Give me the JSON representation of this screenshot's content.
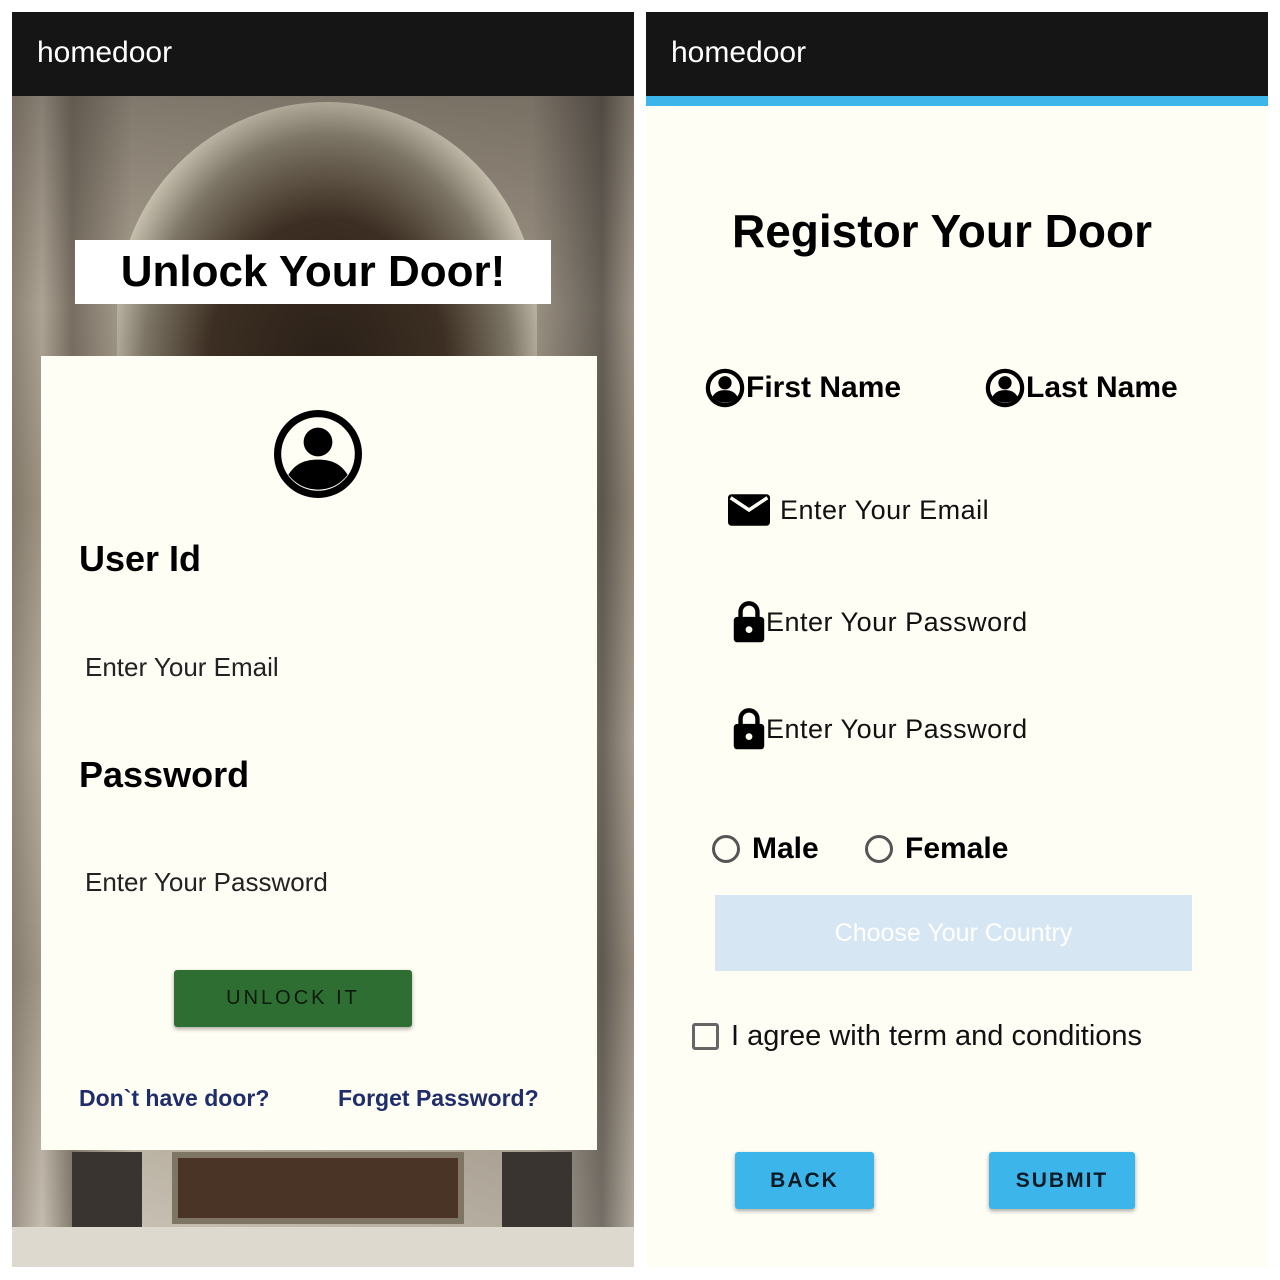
{
  "colors": {
    "appbar": "#151515",
    "accent_blue": "#3cb6ea",
    "unlock_green": "#2e6e32",
    "link_navy": "#1f2d6b",
    "card_bg": "#fffef5",
    "country_bg": "#d6e6f2"
  },
  "login": {
    "app_title": "homedoor",
    "banner_title": "Unlock Your Door!",
    "avatar_icon": "account-circle-icon",
    "user_id_label": "User Id",
    "email_placeholder": "Enter Your Email",
    "password_label": "Password",
    "password_placeholder": "Enter Your Password",
    "unlock_button": "UNLOCK IT",
    "no_door_link": "Don`t have door?",
    "forget_link": "Forget Password?"
  },
  "register": {
    "app_title": "homedoor",
    "title": "Registor Your Door",
    "first_name": "First Name",
    "last_name": "Last Name",
    "email_placeholder": "Enter Your Email",
    "password_placeholder": "Enter  Your  Password",
    "confirm_password_placeholder": "Enter  Your  Password",
    "gender_male": "Male",
    "gender_female": "Female",
    "country_placeholder": "Choose Your Country",
    "agree_text": "I agree with term and conditions",
    "back_button": "BACK",
    "submit_button": "SUBMIT",
    "icons": [
      "person-icon",
      "email-icon",
      "lock-icon",
      "radio-icon",
      "checkbox-icon"
    ]
  }
}
